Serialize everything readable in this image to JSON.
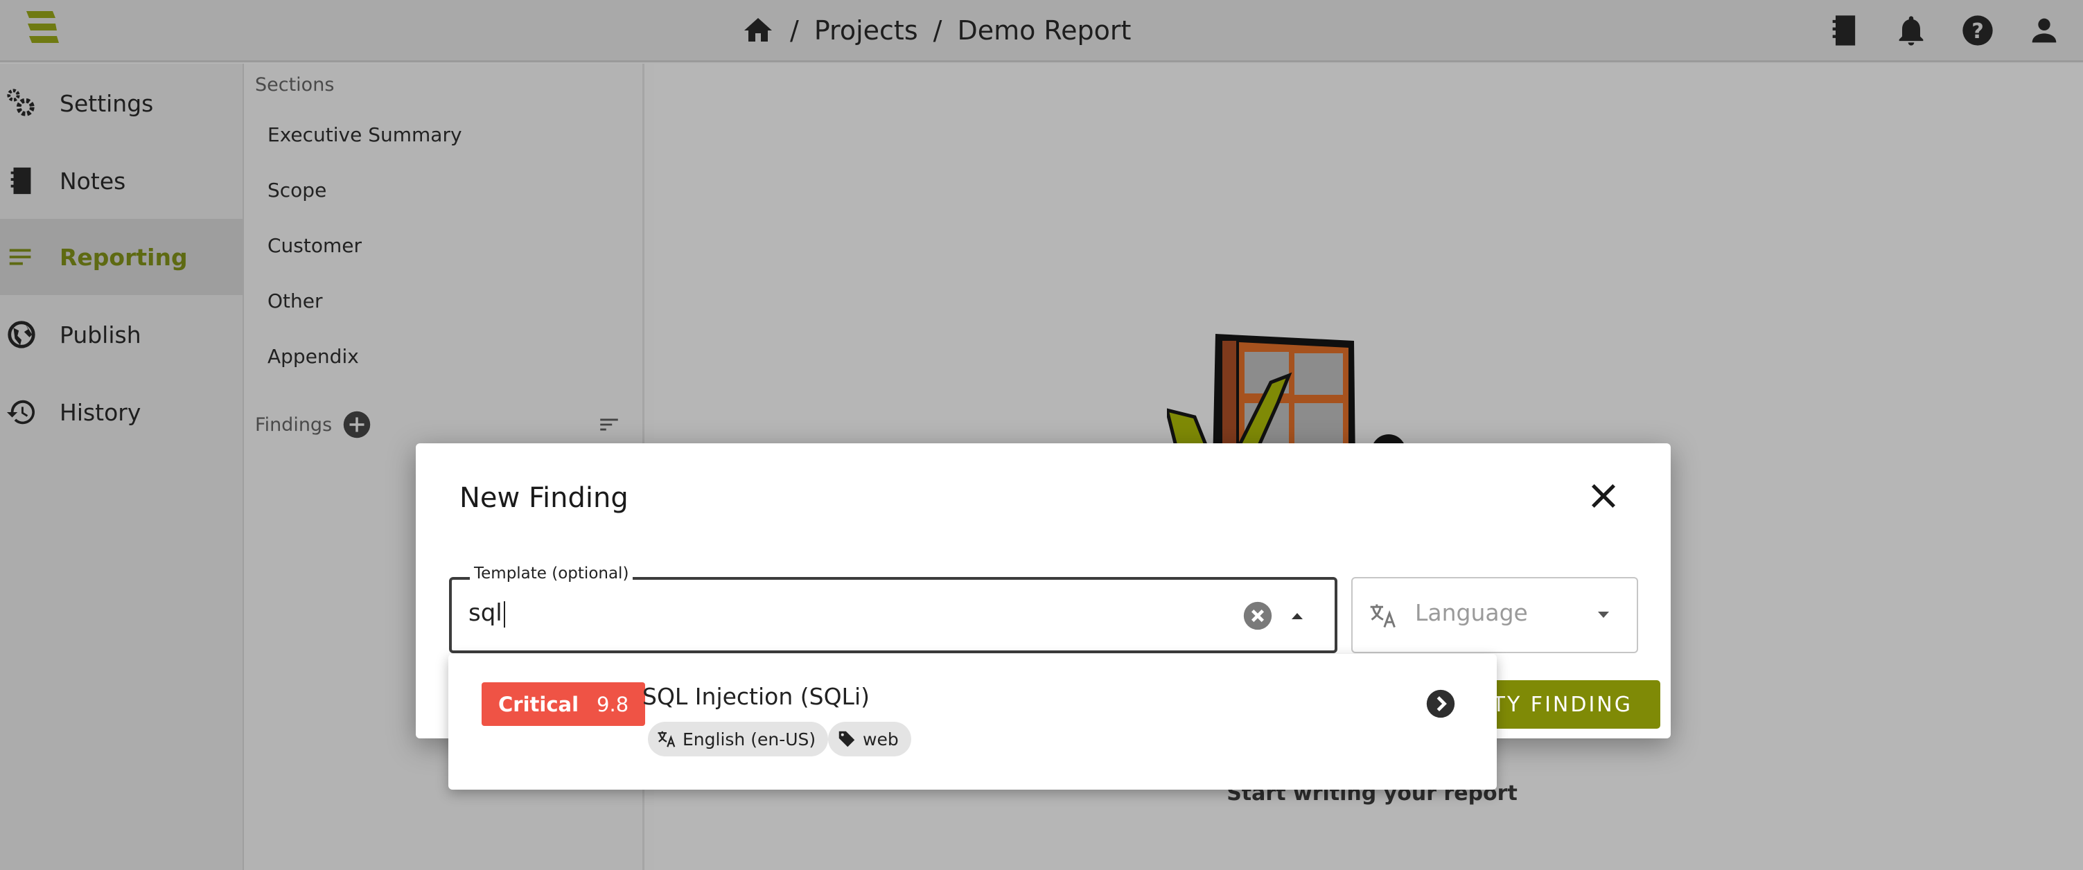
{
  "topbar": {
    "breadcrumb": [
      {
        "icon": "home-icon"
      },
      {
        "label": "Projects"
      },
      {
        "label": "Demo Report"
      }
    ],
    "separator": "/",
    "icons": [
      "notes-icon",
      "bell-icon",
      "help-icon",
      "account-icon"
    ]
  },
  "nav": {
    "items": [
      {
        "label": "Settings",
        "icon": "settings-icon"
      },
      {
        "label": "Notes",
        "icon": "notebook-icon"
      },
      {
        "label": "Reporting",
        "icon": "reporting-icon",
        "selected": true
      },
      {
        "label": "Publish",
        "icon": "globe-icon"
      },
      {
        "label": "History",
        "icon": "history-icon"
      }
    ]
  },
  "sections": {
    "label": "Sections",
    "items": [
      "Executive Summary",
      "Scope",
      "Customer",
      "Other",
      "Appendix"
    ],
    "findings_label": "Findings"
  },
  "main": {
    "empty_text": "Start writing your report"
  },
  "dialog": {
    "title": "New Finding",
    "template_label": "Template (optional)",
    "template_value": "sql",
    "language_placeholder": "Language",
    "button_label": "PTY FINDING"
  },
  "dropdown": {
    "results": [
      {
        "severity": "Critical",
        "score": "9.8",
        "title": "SQL Injection (SQLi)",
        "language": "English (en-US)",
        "tags": [
          "web"
        ]
      }
    ]
  },
  "colors": {
    "accent": "#7f8a06",
    "critical": "#ef5345",
    "selected_text": "#5e6a12"
  }
}
